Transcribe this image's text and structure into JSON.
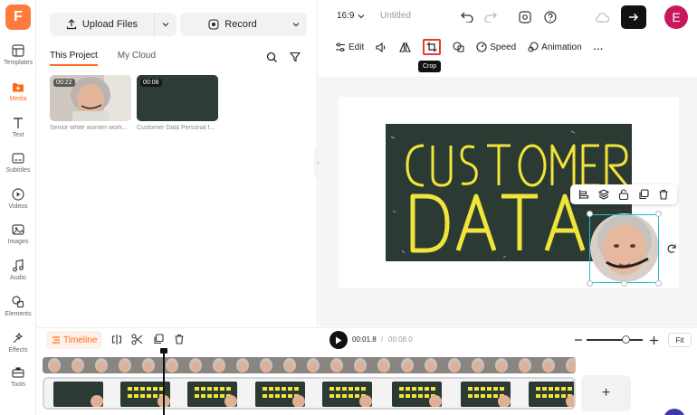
{
  "app": {
    "logo_letter": "F"
  },
  "rail": [
    {
      "label": "Templates",
      "icon": "templates-icon"
    },
    {
      "label": "Media",
      "icon": "media-icon",
      "active": true
    },
    {
      "label": "Text",
      "icon": "text-icon"
    },
    {
      "label": "Subtitles",
      "icon": "subtitles-icon"
    },
    {
      "label": "Videos",
      "icon": "videos-icon"
    },
    {
      "label": "Images",
      "icon": "images-icon"
    },
    {
      "label": "Audio",
      "icon": "audio-icon"
    },
    {
      "label": "Elements",
      "icon": "elements-icon"
    },
    {
      "label": "Effects",
      "icon": "effects-icon"
    },
    {
      "label": "Tools",
      "icon": "tools-icon"
    }
  ],
  "media": {
    "upload_label": "Upload Files",
    "record_label": "Record",
    "tabs": [
      "This Project",
      "My Cloud"
    ],
    "items": [
      {
        "duration": "00:22",
        "caption": "Senior white women work..."
      },
      {
        "duration": "00:08",
        "caption": "Customer Data Personal I..."
      }
    ]
  },
  "topbar": {
    "ratio": "16:9",
    "title": "Untitled",
    "avatar_letter": "E"
  },
  "edit_bar": {
    "edit": "Edit",
    "speed": "Speed",
    "animation": "Animation",
    "more": "..."
  },
  "tooltip": "Crop",
  "timeline": {
    "label": "Timeline",
    "current": "00:01.8",
    "separator": "/",
    "total": "00:08.0",
    "fit": "Fit",
    "zoom_level": 0.63,
    "clip_index": "1",
    "add": "+"
  },
  "colors": {
    "accent": "#ff6a1a",
    "selection": "#19c2d3",
    "chalkboard": "#2c3a34",
    "chalk_text": "#f1e43a"
  }
}
